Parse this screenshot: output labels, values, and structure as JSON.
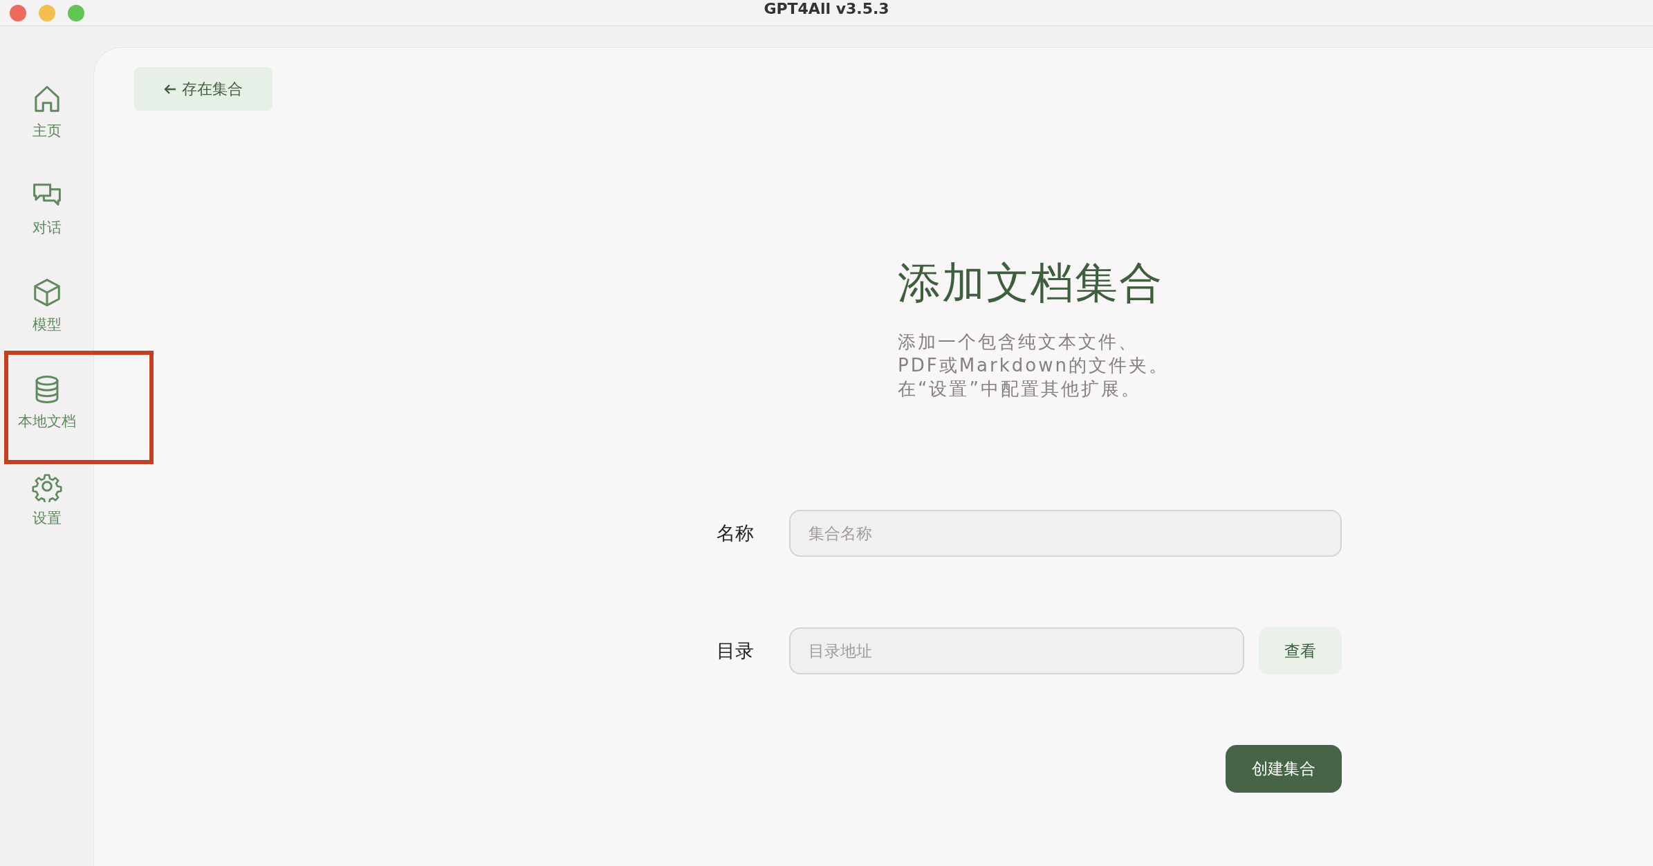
{
  "window": {
    "title": "GPT4All v3.5.3"
  },
  "sidebar": {
    "items": [
      {
        "label": "主页"
      },
      {
        "label": "对话"
      },
      {
        "label": "模型"
      },
      {
        "label": "本地文档"
      },
      {
        "label": "设置"
      }
    ]
  },
  "back_button": {
    "label": "存在集合"
  },
  "heading": "添加文档集合",
  "description": [
    "添加一个包含纯文本文件、",
    "PDF或Markdown的文件夹。",
    "在“设置”中配置其他扩展。"
  ],
  "form": {
    "name": {
      "label": "名称",
      "placeholder": "集合名称"
    },
    "folder": {
      "label": "目录",
      "placeholder": "目录地址",
      "browse_button": "查看"
    },
    "create_button": "创建集合"
  }
}
